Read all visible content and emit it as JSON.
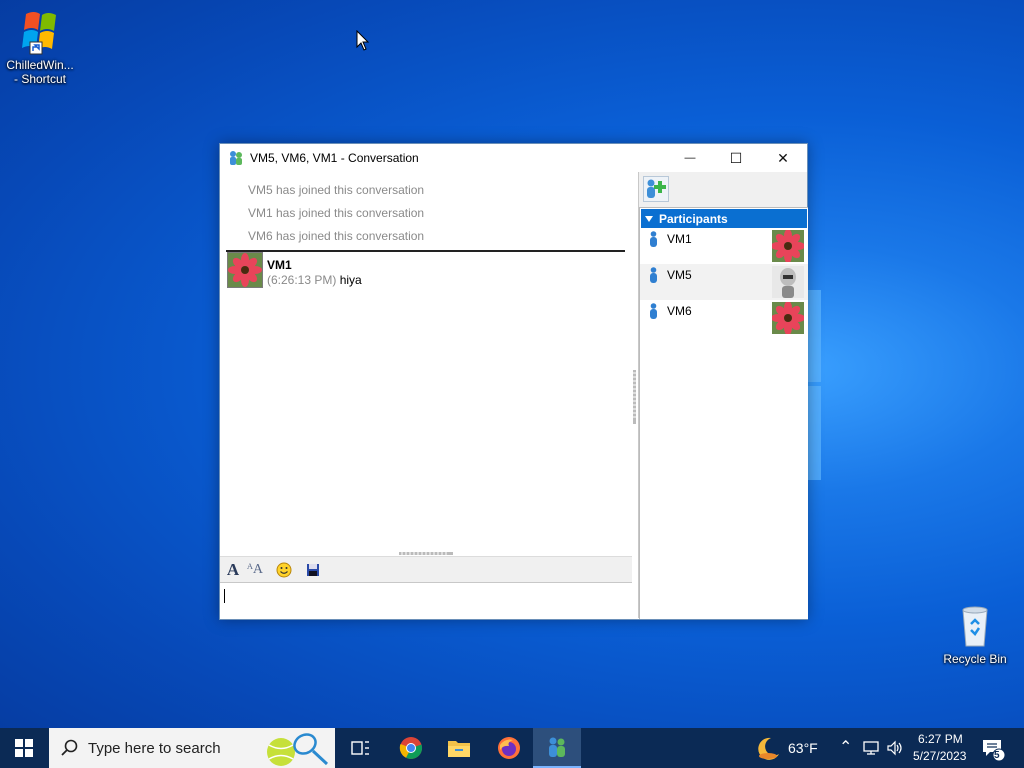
{
  "desktop": {
    "icons": [
      {
        "label": "ChilledWin... - Shortcut",
        "line1": "ChilledWin...",
        "line2": "- Shortcut"
      },
      {
        "label": "Recycle Bin"
      }
    ]
  },
  "window": {
    "title": "VM5, VM6, VM1 - Conversation",
    "controls": {
      "minimize": "—",
      "maximize": "☐",
      "close": "✕"
    }
  },
  "conversation": {
    "system_messages": [
      "VM5 has joined this conversation",
      "VM1 has joined this conversation",
      "VM6 has joined this conversation"
    ],
    "messages": [
      {
        "sender": "VM1",
        "time": "(6:26:13 PM)",
        "text": "hiya"
      }
    ]
  },
  "format_toolbar": {
    "icons": [
      "font-icon",
      "text-color-icon",
      "emoticon-icon",
      "save-icon"
    ]
  },
  "participants": {
    "header": "Participants",
    "items": [
      {
        "name": "VM1",
        "avatar": "flower"
      },
      {
        "name": "VM5",
        "avatar": "robot"
      },
      {
        "name": "VM6",
        "avatar": "flower"
      }
    ]
  },
  "taskbar": {
    "search_placeholder": "Type here to search",
    "weather": "63°F",
    "time": "6:27 PM",
    "date": "5/27/2023",
    "notification_count": "5"
  },
  "colors": {
    "selection_blue": "#0a6fd1",
    "taskbar": "#0b2a55"
  }
}
